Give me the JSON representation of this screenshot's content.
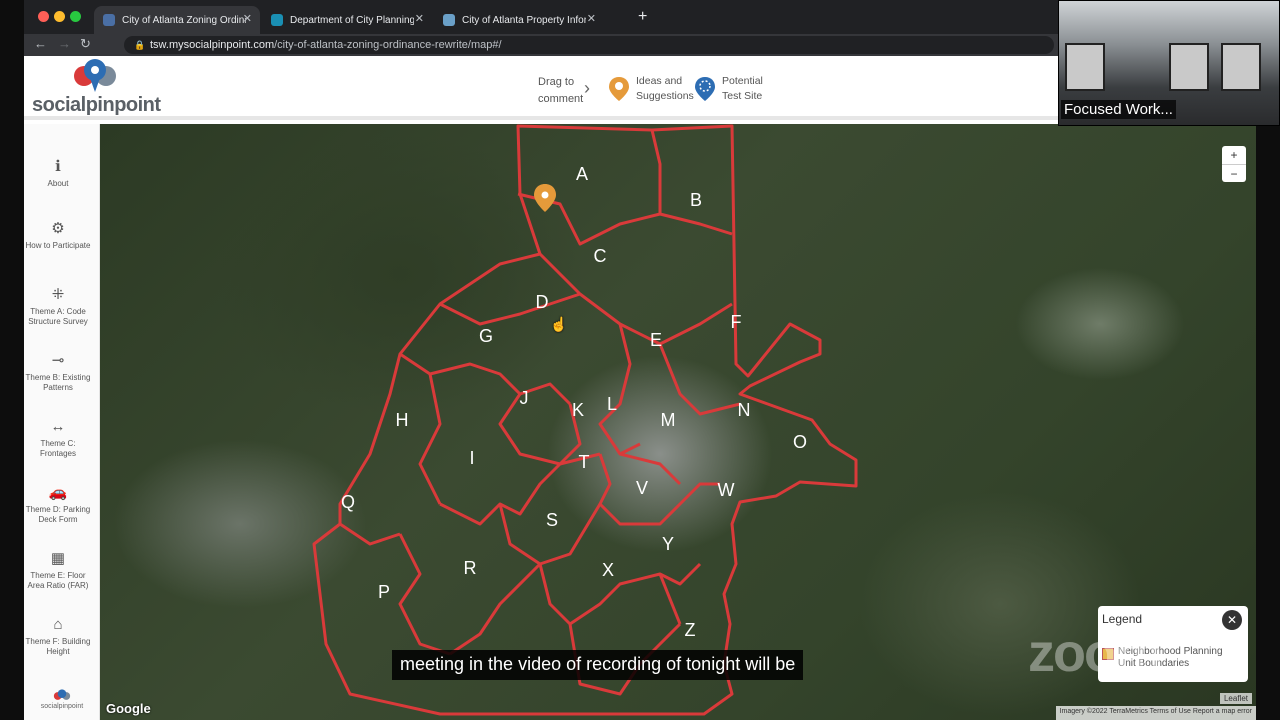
{
  "browser": {
    "tabs": [
      {
        "title": "City of Atlanta Zoning Ordinance",
        "favicon_color": "#4a6fa5"
      },
      {
        "title": "Department of City Planning G",
        "favicon_color": "#1a8fb3"
      },
      {
        "title": "City of Atlanta Property Inform",
        "favicon_color": "#6aa0c8"
      }
    ],
    "close_glyph": "✕",
    "new_tab_glyph": "+",
    "url_host": "tsw.mysocialpinpoint.com",
    "url_path": "/city-of-atlanta-zoning-ordinance-rewrite/map#/"
  },
  "header": {
    "logo_text": "socialpinpoint",
    "drag_hint": "Drag to comment",
    "markers": [
      {
        "label": "Ideas and Suggestions",
        "color": "#e59a3a",
        "icon": "lightbulb-icon"
      },
      {
        "label": "Potential Test Site",
        "color": "#2d6db3",
        "icon": "dots-circle-icon"
      }
    ]
  },
  "sidebar": {
    "items": [
      {
        "label": "About",
        "icon": "info-icon",
        "glyph": "ℹ"
      },
      {
        "label": "How to Participate",
        "icon": "gears-icon",
        "glyph": "⚙"
      },
      {
        "label": "Theme A: Code Structure Survey",
        "icon": "dots-icon",
        "glyph": "⁜"
      },
      {
        "label": "Theme B: Existing Patterns",
        "icon": "pattern-icon",
        "glyph": "⊸"
      },
      {
        "label": "Theme C: Frontages",
        "icon": "arrows-icon",
        "glyph": "↔"
      },
      {
        "label": "Theme D: Parking Deck Form",
        "icon": "car-icon",
        "glyph": "🚗"
      },
      {
        "label": "Theme E: Floor Area Ratio (FAR)",
        "icon": "building-icon",
        "glyph": "▦"
      },
      {
        "label": "Theme F: Building Height",
        "icon": "tower-icon",
        "glyph": "⌂"
      }
    ],
    "brand": "socialpinpoint"
  },
  "map": {
    "zoom_in": "+",
    "zoom_out": "−",
    "boundary_color": "#d93a3a",
    "npu_labels": [
      "A",
      "B",
      "C",
      "D",
      "E",
      "F",
      "G",
      "H",
      "I",
      "J",
      "K",
      "L",
      "M",
      "N",
      "O",
      "P",
      "Q",
      "R",
      "S",
      "T",
      "V",
      "W",
      "X",
      "Y",
      "Z"
    ],
    "legend": {
      "title": "Legend",
      "item": "Neighborhood Planning Unit Boundaries",
      "close": "✕"
    },
    "google": "Google",
    "attribution": "Imagery ©2022 TerraMetrics   Terms of Use   Report a map error",
    "leaflet": "Leaflet"
  },
  "caption": "meeting in the video of recording of tonight will be",
  "watermark": "zoom",
  "video": {
    "name": "Focused Work..."
  }
}
